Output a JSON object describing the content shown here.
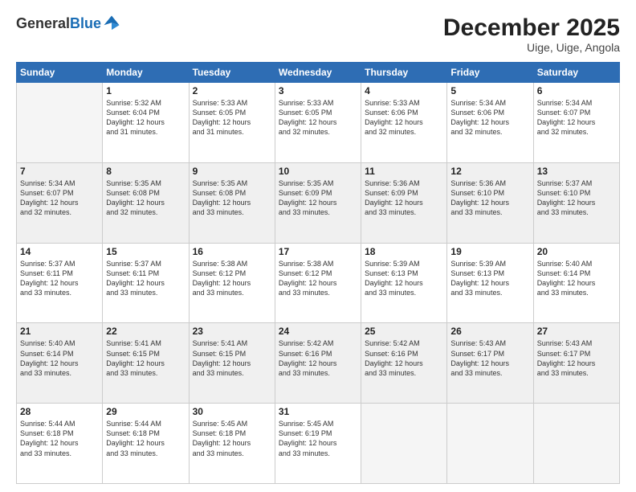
{
  "header": {
    "logo_general": "General",
    "logo_blue": "Blue",
    "title": "December 2025",
    "subtitle": "Uige, Uige, Angola"
  },
  "days_of_week": [
    "Sunday",
    "Monday",
    "Tuesday",
    "Wednesday",
    "Thursday",
    "Friday",
    "Saturday"
  ],
  "weeks": [
    {
      "shaded": false,
      "days": [
        {
          "num": "",
          "info": ""
        },
        {
          "num": "1",
          "info": "Sunrise: 5:32 AM\nSunset: 6:04 PM\nDaylight: 12 hours\nand 31 minutes."
        },
        {
          "num": "2",
          "info": "Sunrise: 5:33 AM\nSunset: 6:05 PM\nDaylight: 12 hours\nand 31 minutes."
        },
        {
          "num": "3",
          "info": "Sunrise: 5:33 AM\nSunset: 6:05 PM\nDaylight: 12 hours\nand 32 minutes."
        },
        {
          "num": "4",
          "info": "Sunrise: 5:33 AM\nSunset: 6:06 PM\nDaylight: 12 hours\nand 32 minutes."
        },
        {
          "num": "5",
          "info": "Sunrise: 5:34 AM\nSunset: 6:06 PM\nDaylight: 12 hours\nand 32 minutes."
        },
        {
          "num": "6",
          "info": "Sunrise: 5:34 AM\nSunset: 6:07 PM\nDaylight: 12 hours\nand 32 minutes."
        }
      ]
    },
    {
      "shaded": true,
      "days": [
        {
          "num": "7",
          "info": "Sunrise: 5:34 AM\nSunset: 6:07 PM\nDaylight: 12 hours\nand 32 minutes."
        },
        {
          "num": "8",
          "info": "Sunrise: 5:35 AM\nSunset: 6:08 PM\nDaylight: 12 hours\nand 32 minutes."
        },
        {
          "num": "9",
          "info": "Sunrise: 5:35 AM\nSunset: 6:08 PM\nDaylight: 12 hours\nand 33 minutes."
        },
        {
          "num": "10",
          "info": "Sunrise: 5:35 AM\nSunset: 6:09 PM\nDaylight: 12 hours\nand 33 minutes."
        },
        {
          "num": "11",
          "info": "Sunrise: 5:36 AM\nSunset: 6:09 PM\nDaylight: 12 hours\nand 33 minutes."
        },
        {
          "num": "12",
          "info": "Sunrise: 5:36 AM\nSunset: 6:10 PM\nDaylight: 12 hours\nand 33 minutes."
        },
        {
          "num": "13",
          "info": "Sunrise: 5:37 AM\nSunset: 6:10 PM\nDaylight: 12 hours\nand 33 minutes."
        }
      ]
    },
    {
      "shaded": false,
      "days": [
        {
          "num": "14",
          "info": "Sunrise: 5:37 AM\nSunset: 6:11 PM\nDaylight: 12 hours\nand 33 minutes."
        },
        {
          "num": "15",
          "info": "Sunrise: 5:37 AM\nSunset: 6:11 PM\nDaylight: 12 hours\nand 33 minutes."
        },
        {
          "num": "16",
          "info": "Sunrise: 5:38 AM\nSunset: 6:12 PM\nDaylight: 12 hours\nand 33 minutes."
        },
        {
          "num": "17",
          "info": "Sunrise: 5:38 AM\nSunset: 6:12 PM\nDaylight: 12 hours\nand 33 minutes."
        },
        {
          "num": "18",
          "info": "Sunrise: 5:39 AM\nSunset: 6:13 PM\nDaylight: 12 hours\nand 33 minutes."
        },
        {
          "num": "19",
          "info": "Sunrise: 5:39 AM\nSunset: 6:13 PM\nDaylight: 12 hours\nand 33 minutes."
        },
        {
          "num": "20",
          "info": "Sunrise: 5:40 AM\nSunset: 6:14 PM\nDaylight: 12 hours\nand 33 minutes."
        }
      ]
    },
    {
      "shaded": true,
      "days": [
        {
          "num": "21",
          "info": "Sunrise: 5:40 AM\nSunset: 6:14 PM\nDaylight: 12 hours\nand 33 minutes."
        },
        {
          "num": "22",
          "info": "Sunrise: 5:41 AM\nSunset: 6:15 PM\nDaylight: 12 hours\nand 33 minutes."
        },
        {
          "num": "23",
          "info": "Sunrise: 5:41 AM\nSunset: 6:15 PM\nDaylight: 12 hours\nand 33 minutes."
        },
        {
          "num": "24",
          "info": "Sunrise: 5:42 AM\nSunset: 6:16 PM\nDaylight: 12 hours\nand 33 minutes."
        },
        {
          "num": "25",
          "info": "Sunrise: 5:42 AM\nSunset: 6:16 PM\nDaylight: 12 hours\nand 33 minutes."
        },
        {
          "num": "26",
          "info": "Sunrise: 5:43 AM\nSunset: 6:17 PM\nDaylight: 12 hours\nand 33 minutes."
        },
        {
          "num": "27",
          "info": "Sunrise: 5:43 AM\nSunset: 6:17 PM\nDaylight: 12 hours\nand 33 minutes."
        }
      ]
    },
    {
      "shaded": false,
      "days": [
        {
          "num": "28",
          "info": "Sunrise: 5:44 AM\nSunset: 6:18 PM\nDaylight: 12 hours\nand 33 minutes."
        },
        {
          "num": "29",
          "info": "Sunrise: 5:44 AM\nSunset: 6:18 PM\nDaylight: 12 hours\nand 33 minutes."
        },
        {
          "num": "30",
          "info": "Sunrise: 5:45 AM\nSunset: 6:18 PM\nDaylight: 12 hours\nand 33 minutes."
        },
        {
          "num": "31",
          "info": "Sunrise: 5:45 AM\nSunset: 6:19 PM\nDaylight: 12 hours\nand 33 minutes."
        },
        {
          "num": "",
          "info": ""
        },
        {
          "num": "",
          "info": ""
        },
        {
          "num": "",
          "info": ""
        }
      ]
    }
  ]
}
